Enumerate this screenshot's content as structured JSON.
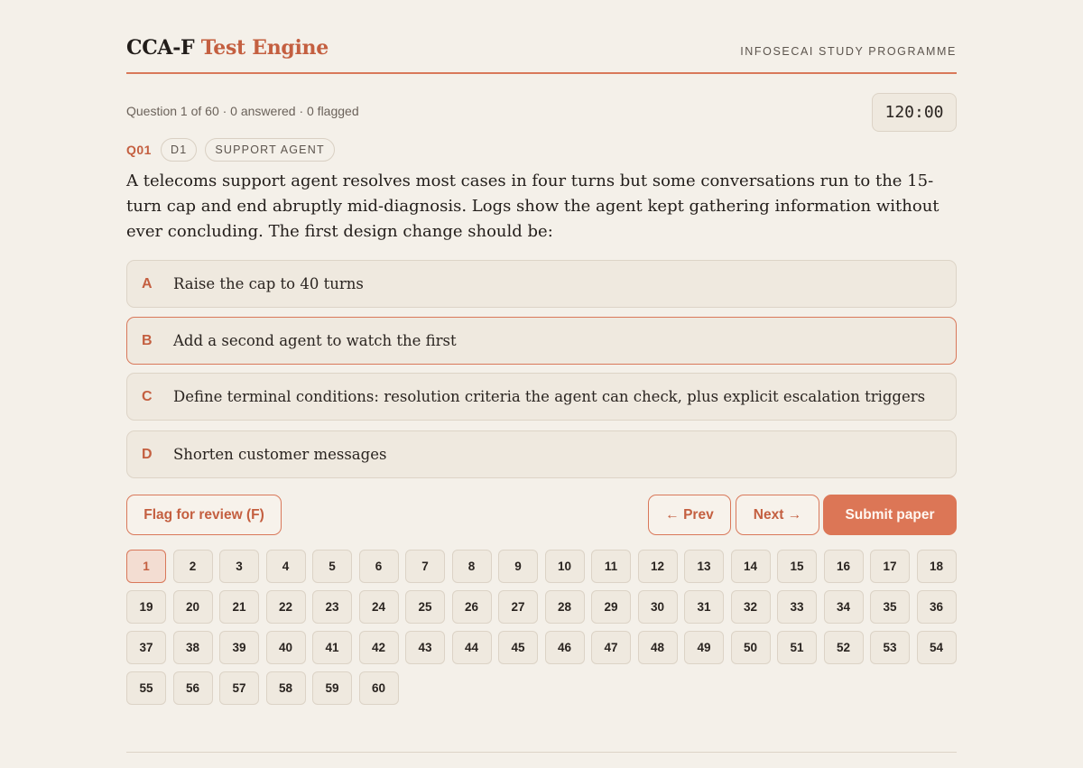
{
  "header": {
    "brand_prefix": "CCA-F",
    "brand_accent": "Test Engine",
    "programme": "INFOSECAI STUDY PROGRAMME"
  },
  "status": {
    "summary": "Question 1 of 60 · 0 answered · 0 flagged",
    "timer": "120:00"
  },
  "question": {
    "id": "Q01",
    "tags": [
      "D1",
      "SUPPORT AGENT"
    ],
    "text": "A telecoms support agent resolves most cases in four turns but some conversations run to the 15-turn cap and end abruptly mid-diagnosis. Logs show the agent kept gathering information without ever concluding. The first design change should be:",
    "options": [
      {
        "letter": "A",
        "text": "Raise the cap to 40 turns"
      },
      {
        "letter": "B",
        "text": "Add a second agent to watch the first"
      },
      {
        "letter": "C",
        "text": "Define terminal conditions: resolution criteria the agent can check, plus explicit escalation triggers"
      },
      {
        "letter": "D",
        "text": "Shorten customer messages"
      }
    ]
  },
  "buttons": {
    "flag": "Flag for review (F)",
    "prev": "← Prev",
    "next": "Next →",
    "submit": "Submit paper"
  },
  "navigator": {
    "current": 1,
    "numbers": [
      "1",
      "2",
      "3",
      "4",
      "5",
      "6",
      "7",
      "8",
      "9",
      "10",
      "11",
      "12",
      "13",
      "14",
      "15",
      "16",
      "17",
      "18",
      "19",
      "20",
      "21",
      "22",
      "23",
      "24",
      "25",
      "26",
      "27",
      "28",
      "29",
      "30",
      "31",
      "32",
      "33",
      "34",
      "35",
      "36",
      "37",
      "38",
      "39",
      "40",
      "41",
      "42",
      "43",
      "44",
      "45",
      "46",
      "47",
      "48",
      "49",
      "50",
      "51",
      "52",
      "53",
      "54",
      "55",
      "56",
      "57",
      "58",
      "59",
      "60"
    ]
  },
  "colors": {
    "accent": "#c45f40",
    "primary_button": "#dc7656",
    "background": "#f4f0e9"
  }
}
